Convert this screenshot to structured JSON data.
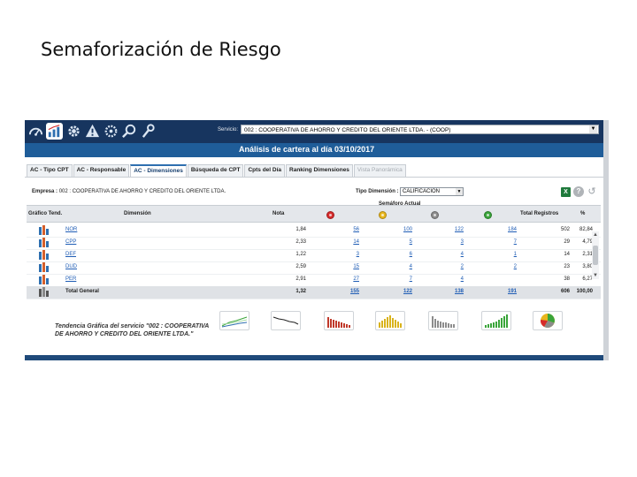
{
  "slide": {
    "title": "Semaforización de Riesgo"
  },
  "toolbar": {
    "icons": [
      "dashboard-icon",
      "chart-icon",
      "gear-icon",
      "warning-icon",
      "settings-icon",
      "search-icon",
      "wrench-icon"
    ],
    "servicio_label": "Servicio:",
    "servicio_value": "002 : COOPERATIVA DE AHORRO Y CREDITO DEL ORIENTE LTDA. - (COOP)"
  },
  "title_bar": {
    "text": "Análisis de cartera al día  03/10/2017"
  },
  "tabs": [
    {
      "label": "AC - Tipo CPT",
      "state": "normal"
    },
    {
      "label": "AC - Responsable",
      "state": "normal"
    },
    {
      "label": "AC - Dimensiones",
      "state": "active"
    },
    {
      "label": "Búsqueda de CPT",
      "state": "normal"
    },
    {
      "label": "Cpts del Día",
      "state": "normal"
    },
    {
      "label": "Ranking Dimensiones",
      "state": "normal"
    },
    {
      "label": "Vista Panorámica",
      "state": "disabled"
    }
  ],
  "filters": {
    "empresa_label": "Empresa :",
    "empresa_value": "002 : COOPERATIVA DE AHORRO Y CREDITO DEL ORIENTE LTDA.",
    "tipo_dimension_label": "Tipo Dimensión :",
    "tipo_dimension_value": "CALIFICACION"
  },
  "table": {
    "headers": {
      "grafico": "Gráfico Tend.",
      "dimension": "Dimensión",
      "nota": "Nota",
      "semaforo": "Semáforo Actual",
      "total": "Total Registros",
      "pct": "%"
    },
    "semaforo_colors": [
      "#d62b2b",
      "#e8b61c",
      "#8c8c8c",
      "#3aa53a"
    ],
    "rows": [
      {
        "dim": "NOR",
        "nota": "1,84",
        "red": "56",
        "yellow": "100",
        "gray": "122",
        "green": "184",
        "total": "502",
        "pct": "82,84"
      },
      {
        "dim": "CPP",
        "nota": "2,33",
        "red": "14",
        "yellow": "5",
        "gray": "3",
        "green": "7",
        "total": "29",
        "pct": "4,79"
      },
      {
        "dim": "DEF",
        "nota": "1,22",
        "red": "3",
        "yellow": "6",
        "gray": "4",
        "green": "1",
        "total": "14",
        "pct": "2,31"
      },
      {
        "dim": "DUD",
        "nota": "2,59",
        "red": "15",
        "yellow": "4",
        "gray": "2",
        "green": "2",
        "total": "23",
        "pct": "3,80"
      },
      {
        "dim": "PER",
        "nota": "2,91",
        "red": "27",
        "yellow": "7",
        "gray": "4",
        "green": "",
        "total": "38",
        "pct": "6,27"
      }
    ],
    "total_row": {
      "dim": "Total General",
      "nota": "1,32",
      "red": "155",
      "yellow": "122",
      "gray": "138",
      "green": "191",
      "total": "606",
      "pct": "100,00"
    }
  },
  "trend": {
    "title_line1": "Tendencia Gráfica del servicio \"002 : COOPERATIVA",
    "title_line2": "DE AHORRO Y CREDITO DEL ORIENTE LTDA.\"",
    "thumbnails": [
      "line-trend-chart",
      "line-chart",
      "red-bar-chart",
      "yellow-bar-chart",
      "gray-bar-chart",
      "green-bar-chart",
      "pie-chart"
    ]
  }
}
